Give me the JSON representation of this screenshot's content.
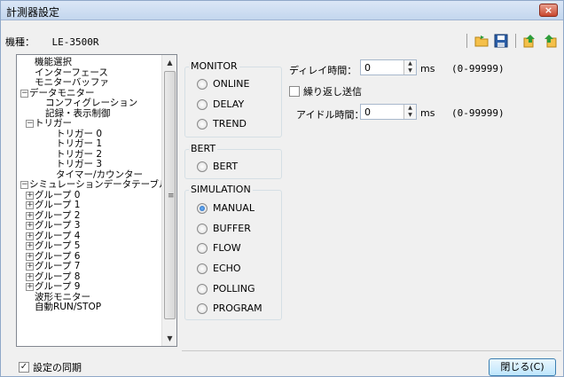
{
  "window": {
    "title": "計測器設定",
    "close_icon": "×"
  },
  "model": {
    "label": "機種：",
    "value": "LE-3500R"
  },
  "toolbar": [
    "folder-open-icon",
    "save-icon",
    "import-icon",
    "export-icon"
  ],
  "tree": {
    "items": [
      {
        "label": "機能選択",
        "level": 1,
        "expander": ""
      },
      {
        "label": "インターフェース",
        "level": 1,
        "expander": ""
      },
      {
        "label": "モニターバッファ",
        "level": 1,
        "expander": ""
      },
      {
        "label": "データモニター",
        "level": 0,
        "expander": "−"
      },
      {
        "label": "コンフィグレーション",
        "level": 2,
        "expander": ""
      },
      {
        "label": "記録・表示制御",
        "level": 2,
        "expander": ""
      },
      {
        "label": "トリガー",
        "level": 1,
        "expander": "−"
      },
      {
        "label": "トリガー 0",
        "level": 3,
        "expander": ""
      },
      {
        "label": "トリガー 1",
        "level": 3,
        "expander": ""
      },
      {
        "label": "トリガー 2",
        "level": 3,
        "expander": ""
      },
      {
        "label": "トリガー 3",
        "level": 3,
        "expander": ""
      },
      {
        "label": "タイマー/カウンター",
        "level": 3,
        "expander": ""
      },
      {
        "label": "シミュレーションデータテーブル",
        "level": 0,
        "expander": "−"
      },
      {
        "label": "グループ 0",
        "level": 1,
        "expander": "+"
      },
      {
        "label": "グループ 1",
        "level": 1,
        "expander": "+"
      },
      {
        "label": "グループ 2",
        "level": 1,
        "expander": "+"
      },
      {
        "label": "グループ 3",
        "level": 1,
        "expander": "+"
      },
      {
        "label": "グループ 4",
        "level": 1,
        "expander": "+"
      },
      {
        "label": "グループ 5",
        "level": 1,
        "expander": "+"
      },
      {
        "label": "グループ 6",
        "level": 1,
        "expander": "+"
      },
      {
        "label": "グループ 7",
        "level": 1,
        "expander": "+"
      },
      {
        "label": "グループ 8",
        "level": 1,
        "expander": "+"
      },
      {
        "label": "グループ 9",
        "level": 1,
        "expander": "+"
      },
      {
        "label": "波形モニター",
        "level": 1,
        "expander": ""
      },
      {
        "label": "自動RUN/STOP",
        "level": 1,
        "expander": ""
      }
    ],
    "scroll_up": "▲",
    "scroll_down": "▼",
    "scroll_grip": "≡"
  },
  "monitor": {
    "title": "MONITOR",
    "options": [
      "ONLINE",
      "DELAY",
      "TREND"
    ],
    "selected": null
  },
  "bert": {
    "title": "BERT",
    "options": [
      "BERT"
    ],
    "selected": null
  },
  "simulation": {
    "title": "SIMULATION",
    "options": [
      "MANUAL",
      "BUFFER",
      "FLOW",
      "ECHO",
      "POLLING",
      "PROGRAM"
    ],
    "selected": "MANUAL"
  },
  "settings": {
    "delay_label": "ディレイ時間：",
    "delay_value": "0",
    "delay_unit": "ms",
    "delay_range": "(0-99999)",
    "repeat_label": "繰り返し送信",
    "repeat_checked": false,
    "idle_label": "アイドル時間：",
    "idle_value": "0",
    "idle_unit": "ms",
    "idle_range": "(0-99999)"
  },
  "footer": {
    "sync_label": "設定の同期",
    "sync_checked": true,
    "close_label": "閉じる(C)"
  }
}
